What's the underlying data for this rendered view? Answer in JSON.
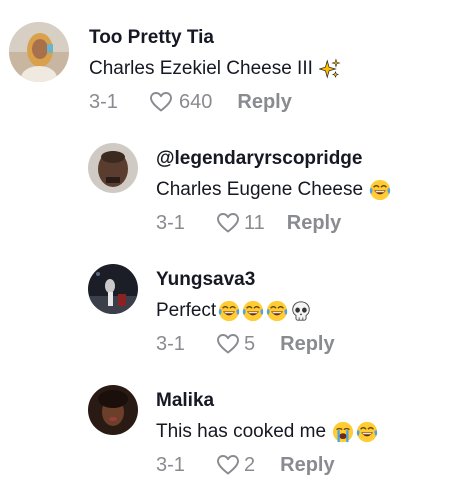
{
  "comments": [
    {
      "username": "Too Pretty Tia",
      "text": "Charles Ezekiel Cheese III",
      "emojis": [
        "sparkles-emoji"
      ],
      "date": "3-1",
      "likes": "640",
      "reply_label": "Reply"
    },
    {
      "username": "@legendaryrscopridge",
      "text": "Charles Eugene Cheese",
      "emojis": [
        "tears-of-joy-emoji"
      ],
      "date": "3-1",
      "likes": "11",
      "reply_label": "Reply"
    },
    {
      "username": "Yungsava3",
      "text": "Perfect",
      "emojis": [
        "tears-of-joy-emoji",
        "tears-of-joy-emoji",
        "tears-of-joy-emoji",
        "skull-emoji"
      ],
      "date": "3-1",
      "likes": "5",
      "reply_label": "Reply"
    },
    {
      "username": "Malika",
      "text": "This has cooked me",
      "emojis": [
        "loudly-crying-emoji",
        "tears-of-joy-emoji"
      ],
      "date": "3-1",
      "likes": "2",
      "reply_label": "Reply"
    }
  ],
  "colors": {
    "primary_text": "#161823",
    "secondary_text": "#8a8b91",
    "background": "#ffffff"
  }
}
